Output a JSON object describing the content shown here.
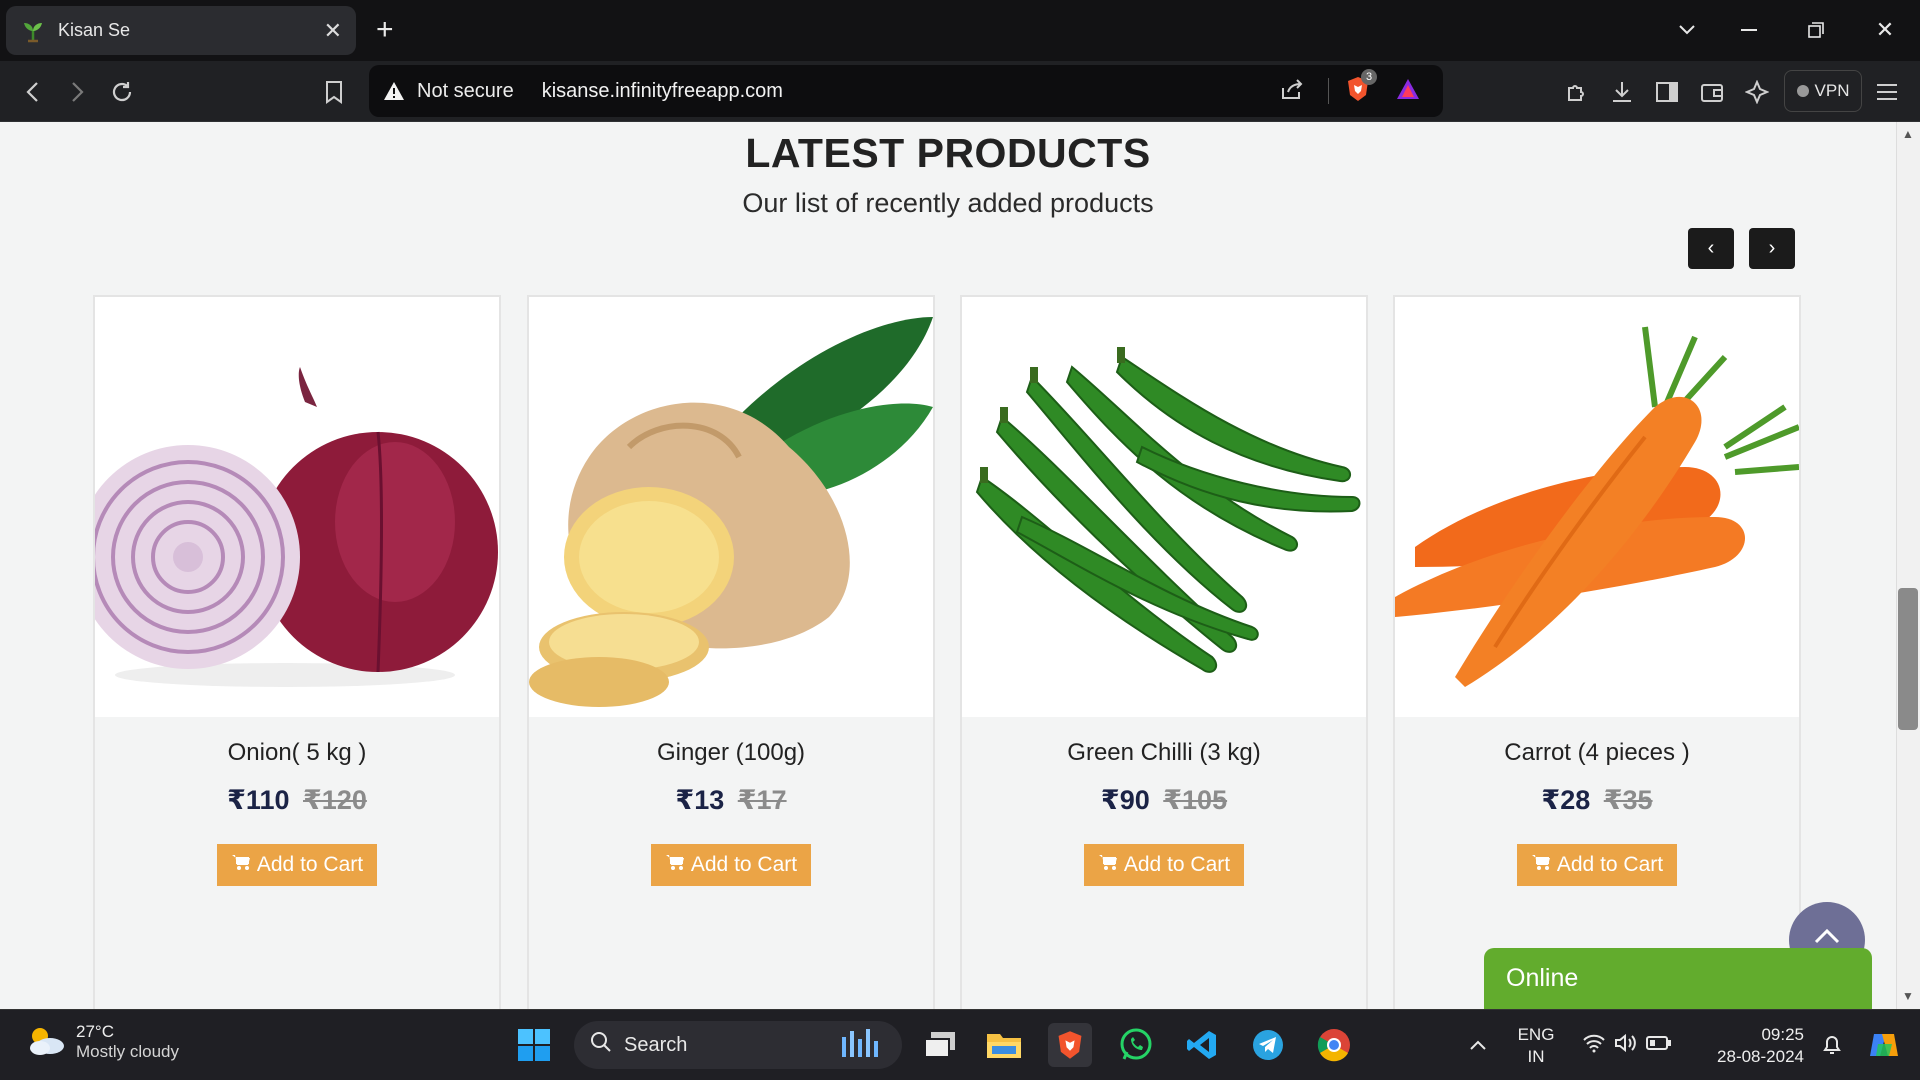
{
  "browser": {
    "tab_title": "Kisan Se",
    "security_label": "Not secure",
    "url": "kisanse.infinityfreeapp.com",
    "vpn_label": "VPN",
    "brave_badge": "3"
  },
  "page": {
    "heading": "LATEST PRODUCTS",
    "subheading": "Our list of recently added products",
    "products": [
      {
        "name": "Onion( 5 kg )",
        "price": "₹110",
        "old_price": "₹120",
        "button": "Add to Cart"
      },
      {
        "name": "Ginger (100g)",
        "price": "₹13",
        "old_price": "₹17",
        "button": "Add to Cart"
      },
      {
        "name": "Green Chilli (3 kg)",
        "price": "₹90",
        "old_price": "₹105",
        "button": "Add to Cart"
      },
      {
        "name": "Carrot (4 pieces )",
        "price": "₹28",
        "old_price": "₹35",
        "button": "Add to Cart"
      }
    ],
    "chat_status": "Online"
  },
  "taskbar": {
    "weather_temp": "27°C",
    "weather_desc": "Mostly cloudy",
    "search_label": "Search",
    "lang_top": "ENG",
    "lang_bottom": "IN",
    "time": "09:25",
    "date": "28-08-2024"
  },
  "colors": {
    "accent_button": "#eba446",
    "chat_green": "#62ac2d",
    "price_navy": "#1b2346"
  }
}
